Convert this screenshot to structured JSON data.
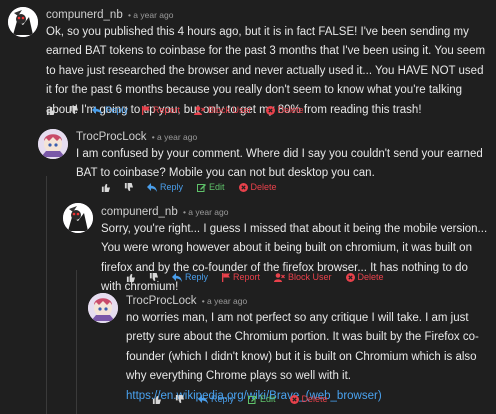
{
  "comments": [
    {
      "user": "compunerd_nb",
      "time": "• a year ago",
      "text": "Ok, so you published this 4 hours ago, but it is in fact FALSE! I've been sending my earned BAT tokens to coinbase for the past 3 months that I've been using it. You seem to have just researched the browser and never actually used it... You HAVE NOT used it for the past 6 months because you really don't seem to know what you're talking about! I'm going to tip you, but only to get my 80% from reading this trash!",
      "actions": {
        "reply": "Reply",
        "report": "Report",
        "block": "Block User",
        "delete": "Delete"
      }
    },
    {
      "user": "TrocProcLock",
      "time": "• a year ago",
      "text": "I am confused by your comment. Where did I say you couldn't send your earned BAT to coinbase? Mobile you can not but desktop you can.",
      "actions": {
        "reply": "Reply",
        "edit": "Edit",
        "delete": "Delete"
      }
    },
    {
      "user": "compunerd_nb",
      "time": "• a year ago",
      "text": "Sorry, you're right... I guess I missed that about it being the mobile version... You were wrong however about it being built on chromium, it was built on firefox and by the co-founder of the firefox browser... It has nothing to do with chromium!",
      "actions": {
        "reply": "Reply",
        "report": "Report",
        "block": "Block User",
        "delete": "Delete"
      }
    },
    {
      "user": "TrocProcLock",
      "time": "• a year ago",
      "text": "no worries man, I am not perfect so any critique I will take. I am just pretty sure about the Chromium portion. It was built by the Firefox co-founder (which I didn't know) but it is built on Chromium which is also why everything Chrome plays so well with it.",
      "link": "https://en.wikipedia.org/wiki/Brave_(web_browser)",
      "actions": {
        "reply": "Reply",
        "edit": "Edit",
        "delete": "Delete"
      }
    }
  ],
  "colors": {
    "background": "#1f1f1f",
    "reply": "#4a9eea",
    "report": "#e8414b",
    "edit": "#5fc26a",
    "link": "#4aa3f0"
  },
  "icons": [
    "thumbs-up-icon",
    "thumbs-down-icon",
    "reply-icon",
    "flag-icon",
    "block-user-icon",
    "edit-icon",
    "delete-icon"
  ]
}
